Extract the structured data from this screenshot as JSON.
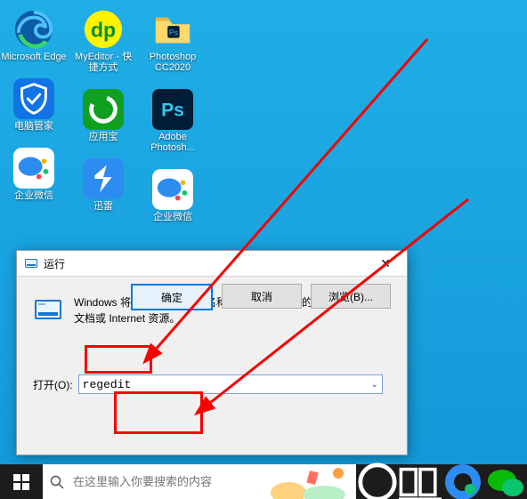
{
  "desktop": {
    "icons": [
      {
        "label": "Microsoft Edge",
        "icon": "edge"
      },
      {
        "label": "MyEditor - 快捷方式",
        "icon": "myeditor"
      },
      {
        "label": "Photoshop CC2020",
        "icon": "psfolder"
      },
      {
        "label": "电脑管家",
        "icon": "guanjia"
      },
      {
        "label": "应用宝",
        "icon": "yingyongbao"
      },
      {
        "label": "Adobe Photosh...",
        "icon": "ps"
      },
      {
        "label": "企业微信",
        "icon": "wecom"
      },
      {
        "label": "迅雷",
        "icon": "xunlei"
      },
      {
        "label": "企业微信",
        "icon": "wecom"
      }
    ]
  },
  "run": {
    "title": "运行",
    "message": "Windows 将根据你所输入的名称，为你打开相应的程序、文件夹、文档或 Internet 资源。",
    "open_label": "打开(O):",
    "input_value": "regedit",
    "buttons": {
      "ok": "确定",
      "cancel": "取消",
      "browse": "浏览(B)..."
    }
  },
  "taskbar": {
    "search_placeholder": "在这里输入你要搜索的内容"
  }
}
